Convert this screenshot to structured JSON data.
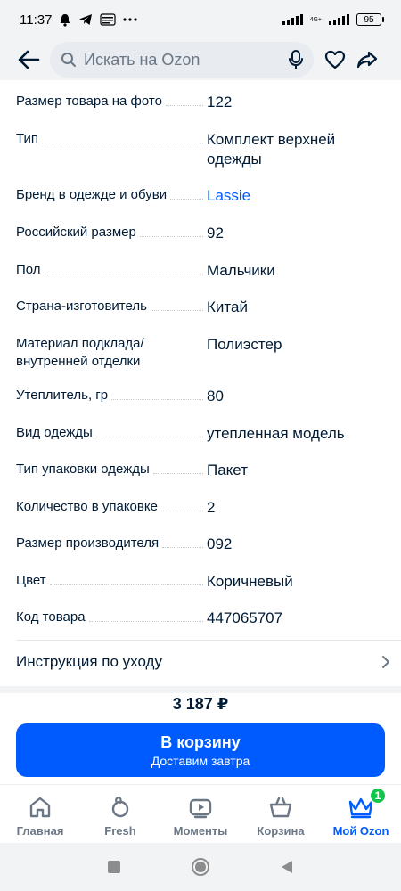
{
  "status_bar": {
    "time": "11:37",
    "network": "4G+",
    "battery": "95"
  },
  "header": {
    "search_placeholder": "Искать на Ozon"
  },
  "specs": [
    {
      "key": "Размер товара на фото",
      "value": "122"
    },
    {
      "key": "Тип",
      "value": "Комплект верхней одежды"
    },
    {
      "key": "Бренд в одежде и обуви",
      "value": "Lassie",
      "link": true
    },
    {
      "key": "Российский размер",
      "value": "92"
    },
    {
      "key": "Пол",
      "value": "Мальчики"
    },
    {
      "key": "Страна-изготовитель",
      "value": "Китай"
    },
    {
      "key": "Материал подклада/ внутренней отделки",
      "value": "Полиэстер"
    },
    {
      "key": "Утеплитель, гр",
      "value": "80"
    },
    {
      "key": "Вид одежды",
      "value": "утепленная модель"
    },
    {
      "key": "Тип упаковки одежды",
      "value": "Пакет"
    },
    {
      "key": "Количество в упаковке",
      "value": "2"
    },
    {
      "key": "Размер производителя",
      "value": "092"
    },
    {
      "key": "Цвет",
      "value": "Коричневый"
    },
    {
      "key": "Код товара",
      "value": "447065707"
    }
  ],
  "care": {
    "label": "Инструкция по уходу"
  },
  "price": "3 187 ₽",
  "cart_button": {
    "label": "В корзину",
    "sublabel": "Доставим завтра"
  },
  "bottom_nav": [
    {
      "label": "Главная",
      "icon": "home-icon"
    },
    {
      "label": "Fresh",
      "icon": "fresh-icon"
    },
    {
      "label": "Моменты",
      "icon": "moments-icon"
    },
    {
      "label": "Корзина",
      "icon": "cart-icon"
    },
    {
      "label": "Мой Ozon",
      "icon": "crown-icon",
      "active": true,
      "badge": "1"
    }
  ],
  "colors": {
    "accent": "#005bff",
    "text": "#001a34",
    "badge": "#10c44c"
  }
}
